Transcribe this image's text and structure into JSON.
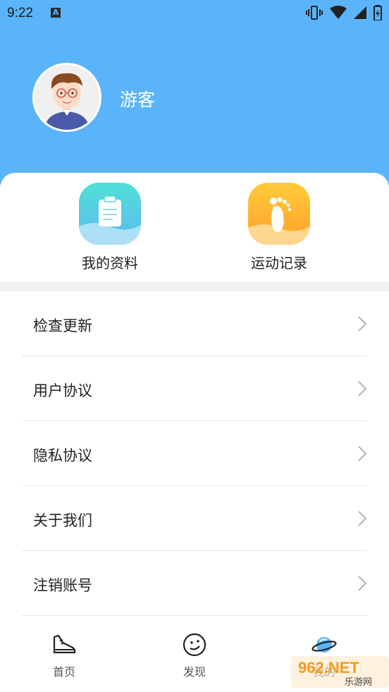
{
  "status_bar": {
    "time": "9:22",
    "keyboard_badge": "A"
  },
  "profile": {
    "name": "游客"
  },
  "quick_actions": [
    {
      "label": "我的资料",
      "icon": "clipboard-icon",
      "color": "#4fd6dc"
    },
    {
      "label": "运动记录",
      "icon": "footprint-icon",
      "color": "#ffb330"
    }
  ],
  "menu": [
    {
      "label": "检查更新"
    },
    {
      "label": "用户协议"
    },
    {
      "label": "隐私协议"
    },
    {
      "label": "关于我们"
    },
    {
      "label": "注销账号"
    }
  ],
  "tabs": [
    {
      "label": "首页",
      "icon": "sneaker-icon"
    },
    {
      "label": "发现",
      "icon": "smiley-icon"
    },
    {
      "label": "我的",
      "icon": "planet-icon"
    }
  ],
  "watermark": {
    "brand": "962.NET",
    "sub": "乐游网"
  },
  "colors": {
    "header": "#5ab4fb",
    "accent_teal": "#4fd6dc",
    "accent_orange": "#ffb330"
  }
}
